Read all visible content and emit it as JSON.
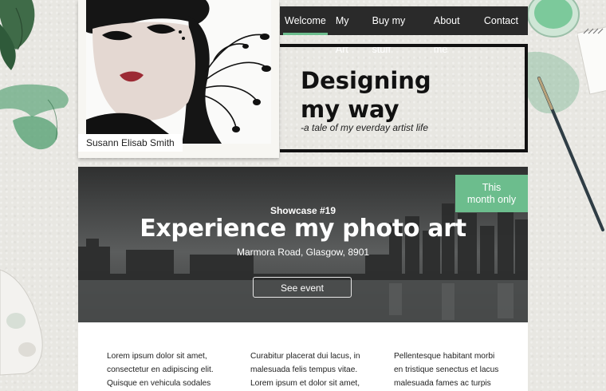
{
  "profile": {
    "name": "Susann Elisab Smith"
  },
  "nav": {
    "items": [
      {
        "label": "Welcome",
        "active": true
      },
      {
        "label": "My Art",
        "active": false
      },
      {
        "label": "Buy my stuff",
        "active": false
      },
      {
        "label": "About me",
        "active": false
      },
      {
        "label": "Contact",
        "active": false
      }
    ]
  },
  "header": {
    "title_line1": "Designing",
    "title_line2": "my way",
    "subtitle": "-a tale of my everday artist life"
  },
  "hero": {
    "badge_line1": "This",
    "badge_line2": "month only",
    "kicker": "Showcase #19",
    "headline": "Experience my photo art",
    "location": "Marmora Road, Glasgow, 8901",
    "button_label": "See event"
  },
  "content": {
    "columns": [
      {
        "lines": [
          "Lorem ipsum dolor sit amet,",
          "consectetur en adipiscing elit.",
          "Quisque en vehicula sodales"
        ]
      },
      {
        "lines": [
          "Curabitur placerat dui lacus, in",
          "malesuada felis tempus vitae.",
          "Lorem ipsum et dolor sit amet,"
        ]
      },
      {
        "lines": [
          "Pellentesque habitant morbi",
          "en tristique senectus et lacus",
          "malesuada fames ac turpis"
        ]
      }
    ]
  },
  "colors": {
    "accent": "#6cbd8d",
    "nav_bg": "#2a2a2a",
    "watercolor": "#4f9e6e"
  }
}
